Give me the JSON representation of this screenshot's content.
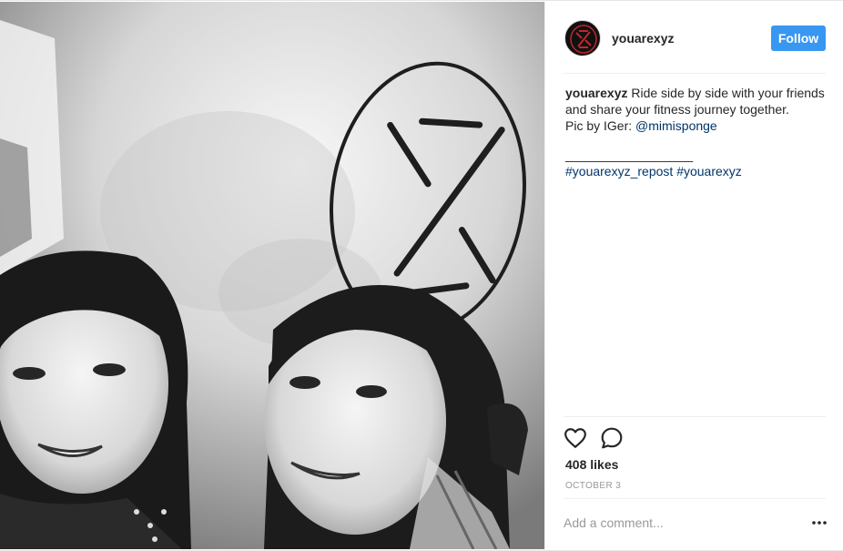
{
  "post": {
    "username": "youarexyz",
    "follow_label": "Follow",
    "caption": {
      "user": "youarexyz",
      "text_1": " Ride side by side with your friends and share your fitness journey together.",
      "text_2": "Pic by IGer: ",
      "mention": "@mimisponge",
      "divider": "__________________",
      "hashtag_1": "#youarexyz_repost",
      "hashtag_2": "#youarexyz"
    },
    "likes": "408 likes",
    "date": "OCTOBER 3",
    "comment_placeholder": "Add a comment...",
    "colors": {
      "follow_bg": "#3897f0",
      "link": "#003569",
      "muted": "#999999"
    },
    "icons": {
      "like": "heart-icon",
      "comment": "comment-bubble-icon",
      "more": "more-options-icon"
    }
  }
}
